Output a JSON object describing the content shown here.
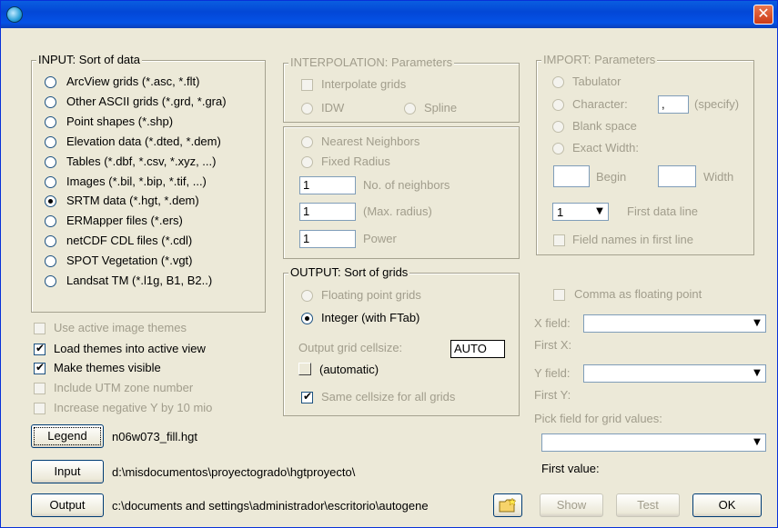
{
  "window": {
    "title": ""
  },
  "input_group": {
    "legend": "INPUT: Sort of data",
    "options": [
      "ArcView grids (*.asc, *.flt)",
      "Other ASCII grids (*.grd, *.gra)",
      "Point shapes (*.shp)",
      "Elevation data (*.dted, *.dem)",
      "Tables (*.dbf, *.csv, *.xyz, ...)",
      "Images (*.bil, *.bip, *.tif, ...)",
      "SRTM data (*.hgt, *.dem)",
      "ERMapper files (*.ers)",
      "netCDF CDL files (*.cdl)",
      "SPOT Vegetation (*.vgt)",
      "Landsat TM (*.l1g, B1, B2..)"
    ],
    "selected_index": 6
  },
  "checks": {
    "use_active": "Use active image themes",
    "load_themes": "Load themes into active view",
    "make_visible": "Make themes visible",
    "include_utm": "Include UTM zone number",
    "increase_neg": "Increase negative Y by 10 mio"
  },
  "interp": {
    "legend": "INTERPOLATION: Parameters",
    "interpolate": "Interpolate grids",
    "idw": "IDW",
    "spline": "Spline",
    "nearest": "Nearest Neighbors",
    "fixed": "Fixed Radius",
    "neighbors_value": "1",
    "neighbors_label": "No. of neighbors",
    "radius_value": "1",
    "radius_label": "(Max. radius)",
    "power_value": "1",
    "power_label": "Power"
  },
  "output_group": {
    "legend": "OUTPUT: Sort of grids",
    "floating": "Floating point grids",
    "integer": "Integer (with FTab)",
    "cellsize_label": "Output grid cellsize:",
    "cellsize_value": "AUTO",
    "automatic": "(automatic)",
    "same_cellsize": "Same cellsize for all grids"
  },
  "import_group": {
    "legend": "IMPORT: Parameters",
    "tabulator": "Tabulator",
    "character": "Character:",
    "character_value": ",",
    "specify": "(specify)",
    "blank": "Blank space",
    "exact": "Exact Width:",
    "begin": "Begin",
    "width": "Width",
    "first_line_value": "1",
    "first_line_label": "First data line",
    "field_names": "Field names in first line"
  },
  "right_panel": {
    "comma": "Comma as floating point",
    "x_field": "X field:",
    "first_x": "First X:",
    "y_field": "Y field:",
    "first_y": "First Y:",
    "pick_field": "Pick field for grid values:",
    "first_value": "First value:"
  },
  "bottom": {
    "legend_btn": "Legend",
    "legend_text": "n06w073_fill.hgt",
    "input_btn": "Input",
    "input_path": "d:\\misdocumentos\\proyectogrado\\hgtproyecto\\",
    "output_btn": "Output",
    "output_path": "c:\\documents and settings\\administrador\\escritorio\\autogene",
    "show_btn": "Show",
    "test_btn": "Test",
    "ok_btn": "OK"
  },
  "icons": [
    "app-globe-icon",
    "close-icon",
    "new-folder-icon",
    "combo-arrow-icon"
  ]
}
